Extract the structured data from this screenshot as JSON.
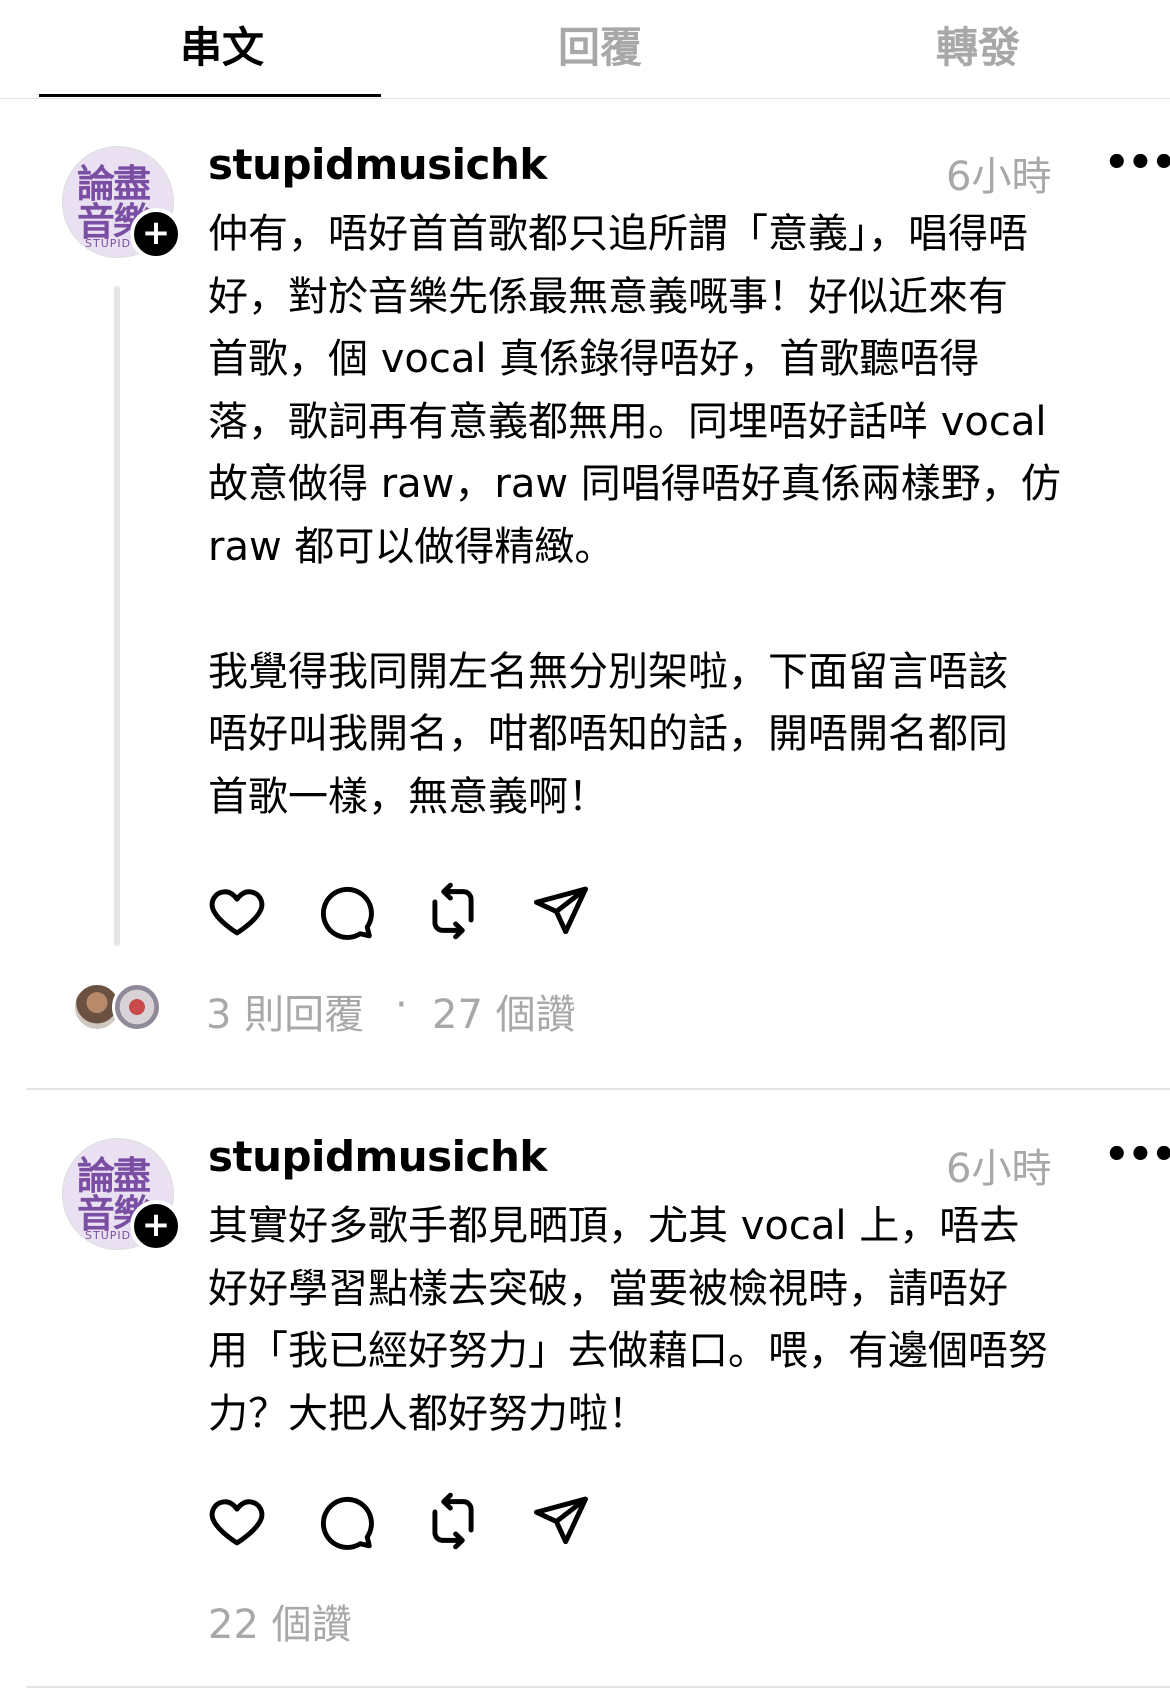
{
  "tabs": [
    "串文",
    "回覆",
    "轉發"
  ],
  "posts": [
    {
      "avatar": {
        "line1": "論盡",
        "line2": "音樂",
        "sub": "STUPID M"
      },
      "username": "stupidmusichk",
      "time": "6小時",
      "more": "•••",
      "text": "仲有，唔好首首歌都只追所謂「意義」，唱得唔\n好，對於音樂先係最無意義嘅事！好似近來有\n首歌，個 vocal 真係錄得唔好，首歌聽唔得\n落，歌詞再有意義都無用。同埋唔好話咩 vocal\n故意做得 raw，raw 同唱得唔好真係兩樣野，仿\nraw 都可以做得精緻。\n\n我覺得我同開左名無分別架啦，下面留言唔該\n唔好叫我開名，咁都唔知的話，開唔開名都同\n首歌一樣，無意義啊！",
      "replies": "3 則回覆",
      "separator": "·",
      "likes": "27 個讚"
    },
    {
      "avatar": {
        "line1": "論盡",
        "line2": "音樂",
        "sub": "STUPID M"
      },
      "username": "stupidmusichk",
      "time": "6小時",
      "more": "•••",
      "text": "其實好多歌手都見晒頂，尤其 vocal 上，唔去\n好好學習點樣去突破，當要被檢視時，請唔好\n用「我已經好努力」去做藉口。喂，有邊個唔努\n力？大把人都好努力啦！",
      "likes": "22 個讚"
    }
  ],
  "icons": [
    "heart-icon",
    "comment-icon",
    "repost-icon",
    "share-icon",
    "plus-icon"
  ],
  "colors": {
    "muted": "#a8a8a8",
    "avatar_bg": "#e9e1f2",
    "avatar_text": "#7a4fa3"
  }
}
